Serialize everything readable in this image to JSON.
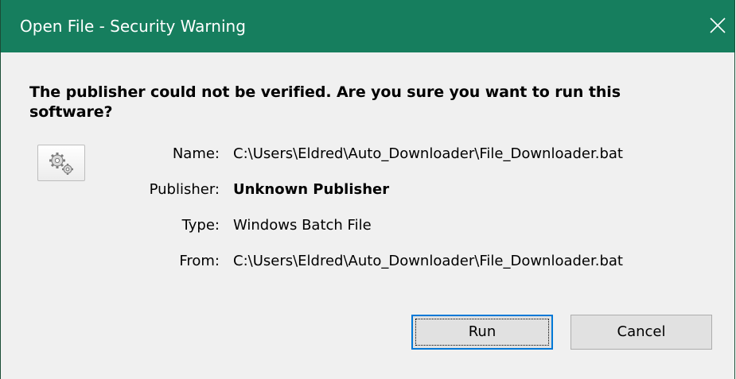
{
  "window": {
    "title": "Open File - Security Warning",
    "titlebar_color": "#167e5e"
  },
  "message": {
    "headline": "The publisher could not be verified.  Are you sure you want to run this software?"
  },
  "icon": {
    "name": "gears-icon"
  },
  "details": [
    {
      "label": "Name:",
      "value": "C:\\Users\\Eldred\\Auto_Downloader\\File_Downloader.bat"
    },
    {
      "label": "Publisher:",
      "value": "Unknown Publisher"
    },
    {
      "label": "Type:",
      "value": "Windows Batch File"
    },
    {
      "label": "From:",
      "value": "C:\\Users\\Eldred\\Auto_Downloader\\File_Downloader.bat"
    }
  ],
  "buttons": {
    "run_label": "Run",
    "cancel_label": "Cancel",
    "focus_color": "#0078d7"
  }
}
